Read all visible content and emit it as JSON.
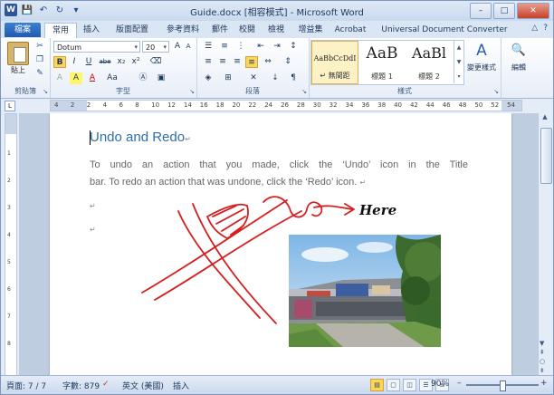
{
  "window": {
    "title": "Guide.docx [相容模式] - Microsoft Word",
    "controls": {
      "minimize": "–",
      "maximize": "□",
      "close": "✕"
    }
  },
  "qat": {
    "app": "W",
    "save": "💾",
    "undo": "↶",
    "redo": "↻",
    "customize": "▾"
  },
  "tabs": {
    "file": "檔案",
    "items": [
      "常用",
      "插入",
      "版面配置",
      "參考資料",
      "郵件",
      "校閱",
      "檢視",
      "增益集",
      "Acrobat",
      "Universal Document Converter"
    ],
    "active_index": 0,
    "help": [
      "△",
      "?"
    ]
  },
  "ribbon": {
    "clipboard": {
      "paste": "貼上",
      "label": "剪貼簿"
    },
    "font": {
      "name": "Dotum",
      "size": "20",
      "label": "字型",
      "buttons": [
        "B",
        "I",
        "U",
        "abe",
        "x₂",
        "x²",
        "A",
        "A",
        "Aa",
        "A"
      ]
    },
    "paragraph": {
      "label": "段落"
    },
    "styles": {
      "label": "樣式",
      "items": [
        {
          "sample": "AaBbCcDdI",
          "name": "↵ 無間距"
        },
        {
          "sample": "AaB",
          "name": "標題 1"
        },
        {
          "sample": "AaBl",
          "name": "標題 2"
        }
      ],
      "change_styles": "變更樣式"
    },
    "editing": {
      "label": "編輯"
    }
  },
  "ruler": {
    "numbers": [
      "4",
      "2",
      "2",
      "4",
      "6",
      "8",
      "10",
      "12",
      "14",
      "16",
      "18",
      "20",
      "22",
      "24",
      "26",
      "28",
      "30",
      "32",
      "34",
      "36",
      "38",
      "40",
      "42",
      "44",
      "46",
      "48",
      "50",
      "52",
      "54"
    ]
  },
  "document": {
    "title": "Undo and Redo",
    "paragraph_line1": "To undo an action that you made, click the ‘Undo’ icon in the Title",
    "paragraph_line2": "bar. To redo an action that was undone, click the ‘Redo’ icon.",
    "pilcrow": "↵",
    "annotation_text": "Here"
  },
  "status": {
    "page": "頁面: 7 / 7",
    "words": "字數: 879",
    "language": "英文 (美國)",
    "mode": "插入",
    "zoom": "90%",
    "zoom_fraction": 0.5,
    "zoom_minus": "–",
    "zoom_plus": "+"
  },
  "colors": {
    "accent": "#2b5797",
    "annotation": "#d42020",
    "title_text": "#2e6fa7"
  }
}
